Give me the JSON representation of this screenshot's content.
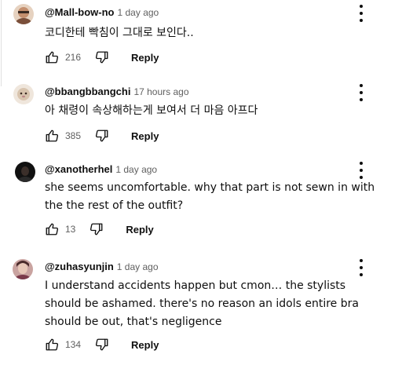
{
  "comments": [
    {
      "handle": "@Mall-bow-no",
      "time": "1 day ago",
      "text": "코디한테 빡침이 그대로 보인다..",
      "likes": "216",
      "reply_label": "Reply",
      "avatar_color": "#b07a5a"
    },
    {
      "handle": "@bbangbbangchi",
      "time": "17 hours ago",
      "text": "아 채령이 속상해하는게 보여서 더 마음 아프다",
      "likes": "385",
      "reply_label": "Reply",
      "avatar_color": "#d9c9b8"
    },
    {
      "handle": "@xanotherhel",
      "time": "1 day ago",
      "text": "she seems uncomfortable. why that part is not sewn in with the the rest of the outfit?",
      "likes": "13",
      "reply_label": "Reply",
      "avatar_color": "#1c1c1c"
    },
    {
      "handle": "@zuhasyunjin",
      "time": "1 day ago",
      "text": "I understand accidents happen but cmon… the stylists should be ashamed. there's no reason an idols entire bra should be out, that's negligence",
      "likes": "134",
      "reply_label": "Reply",
      "avatar_color": "#8a4a5a"
    }
  ],
  "icons": {
    "like": "thumb-up-icon",
    "dislike": "thumb-down-icon",
    "more": "more-vert-icon"
  }
}
